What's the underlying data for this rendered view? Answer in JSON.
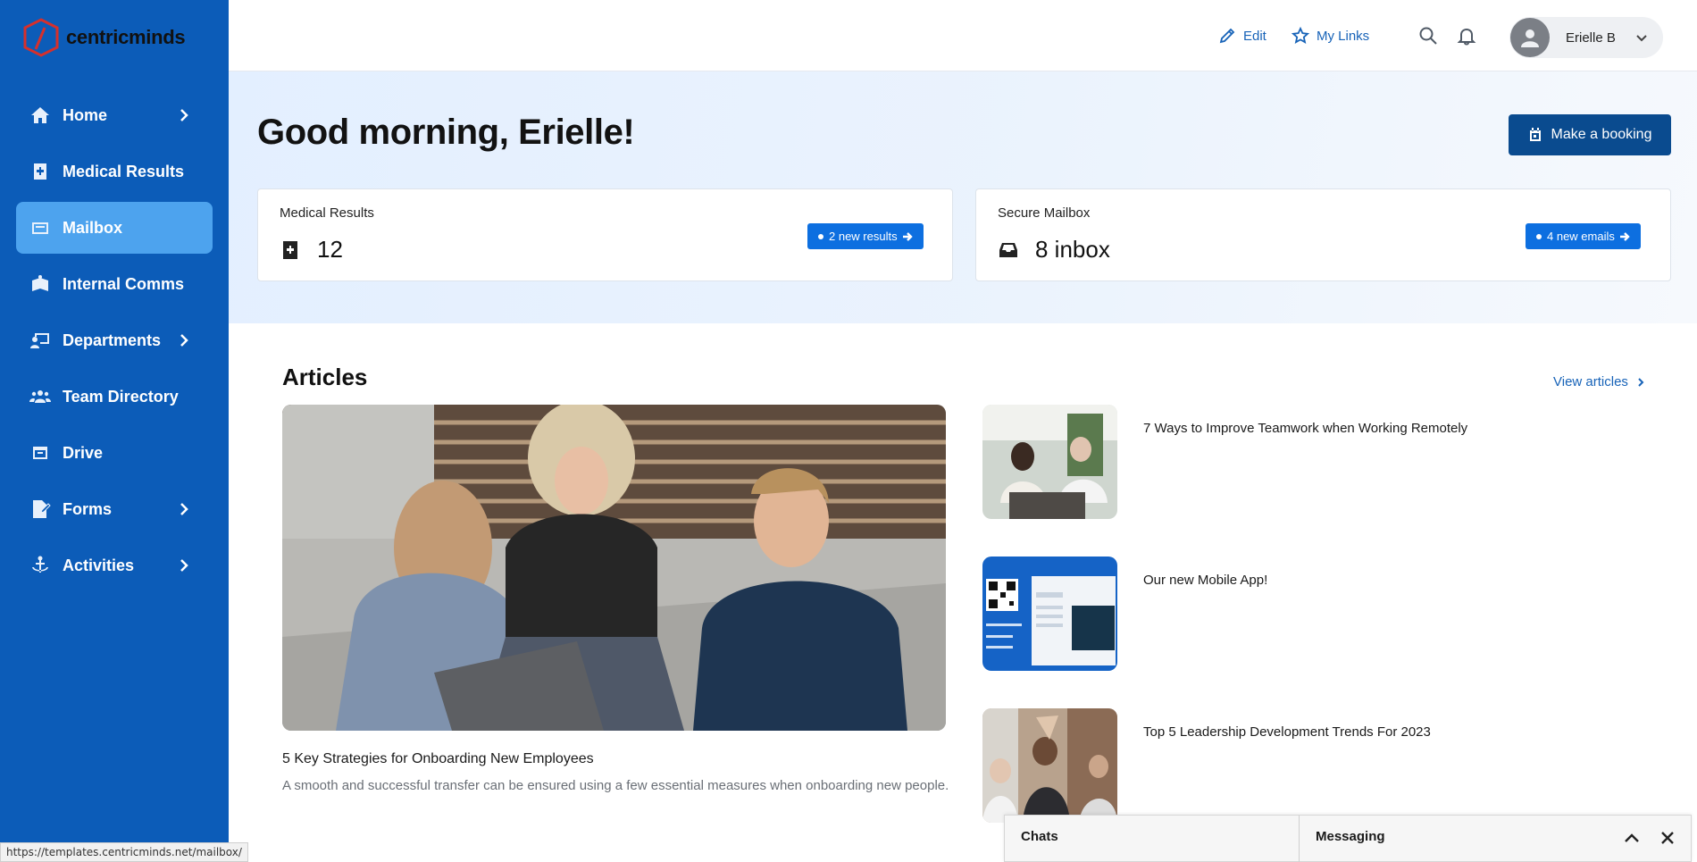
{
  "brand": {
    "name": "centricminds",
    "accent": "#0c5cb8",
    "logo_mark": "#d6302c"
  },
  "sidebar": {
    "items": [
      {
        "label": "Home",
        "icon": "home-icon",
        "has_children": true,
        "active": false
      },
      {
        "label": "Medical Results",
        "icon": "medical-plus-icon",
        "has_children": false,
        "active": false
      },
      {
        "label": "Mailbox",
        "icon": "mailbox-icon",
        "has_children": false,
        "active": true
      },
      {
        "label": "Internal Comms",
        "icon": "comms-icon",
        "has_children": false,
        "active": false
      },
      {
        "label": "Departments",
        "icon": "departments-icon",
        "has_children": true,
        "active": false
      },
      {
        "label": "Team Directory",
        "icon": "team-icon",
        "has_children": false,
        "active": false
      },
      {
        "label": "Drive",
        "icon": "drive-icon",
        "has_children": false,
        "active": false
      },
      {
        "label": "Forms",
        "icon": "forms-icon",
        "has_children": true,
        "active": false
      },
      {
        "label": "Activities",
        "icon": "anchor-icon",
        "has_children": true,
        "active": false
      }
    ]
  },
  "topbar": {
    "edit_label": "Edit",
    "links_label": "My Links",
    "user_name": "Erielle B"
  },
  "hero": {
    "greeting": "Good morning, Erielle!",
    "booking_label": "Make a booking",
    "cards": [
      {
        "title": "Medical Results",
        "value": "12",
        "badge": "2 new results"
      },
      {
        "title": "Secure Mailbox",
        "value": "8 inbox",
        "badge": "4 new emails"
      }
    ]
  },
  "articles": {
    "heading": "Articles",
    "view_all": "View articles",
    "featured": {
      "title": "5 Key Strategies for Onboarding New Employees",
      "summary": "A smooth and successful transfer can be ensured using a few essential measures when onboarding new people."
    },
    "list": [
      {
        "title": "7 Ways to Improve Teamwork when Working Remotely"
      },
      {
        "title": "Our new Mobile App!"
      },
      {
        "title": "Top 5 Leadership Development Trends For 2023"
      }
    ]
  },
  "chat": {
    "chats_label": "Chats",
    "messaging_label": "Messaging"
  },
  "status_url": "https://templates.centricminds.net/mailbox/"
}
